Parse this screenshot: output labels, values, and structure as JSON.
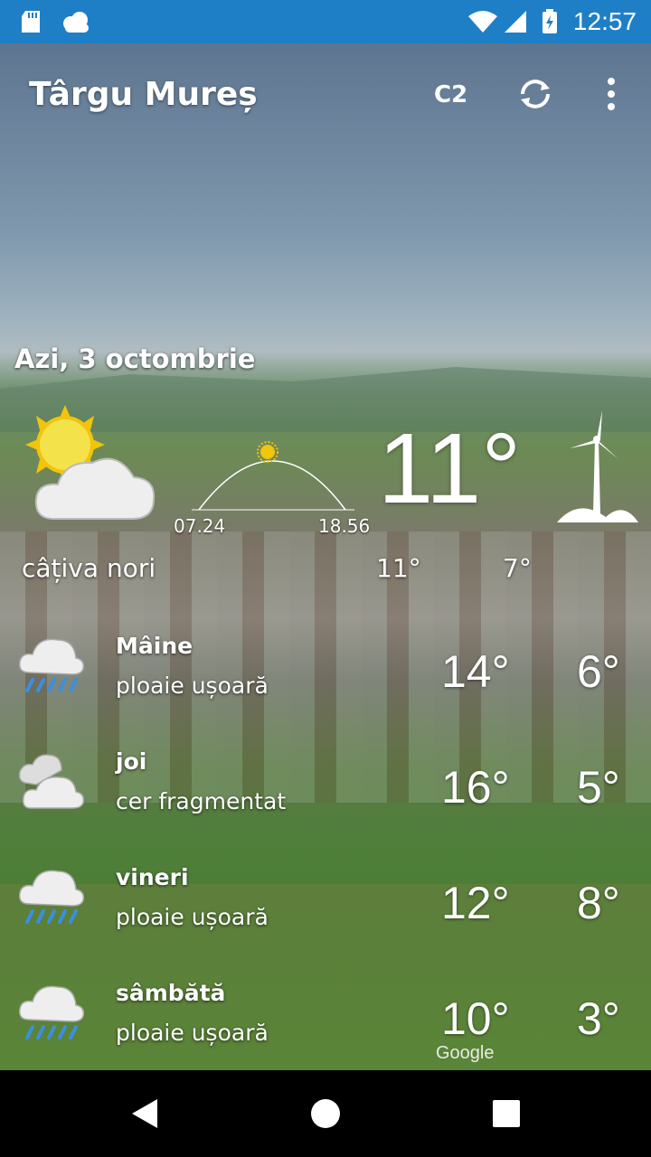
{
  "status_bar": {
    "time": "12:57"
  },
  "app_bar": {
    "city": "Târgu Mureș",
    "unit_label": "C2"
  },
  "today": {
    "date": "Azi, 3 octombrie",
    "sunrise": "07.24",
    "sunset": "18.56",
    "temp": "11°",
    "condition": "câțiva nori",
    "high": "11°",
    "low": "7°"
  },
  "forecast": [
    {
      "day": "Mâine",
      "desc": "ploaie ușoară",
      "high": "14°",
      "low": "6°",
      "icon": "rain-cloud-icon"
    },
    {
      "day": "joi",
      "desc": "cer fragmentat",
      "high": "16°",
      "low": "5°",
      "icon": "broken-clouds-icon"
    },
    {
      "day": "vineri",
      "desc": "ploaie ușoară",
      "high": "12°",
      "low": "8°",
      "icon": "rain-cloud-icon"
    },
    {
      "day": "sâmbătă",
      "desc": "ploaie ușoară",
      "high": "10°",
      "low": "3°",
      "icon": "rain-cloud-icon"
    }
  ],
  "attribution": "Google",
  "colors": {
    "status_bar": "#1e7fc6",
    "rain_drops": "#3a8fe0"
  }
}
